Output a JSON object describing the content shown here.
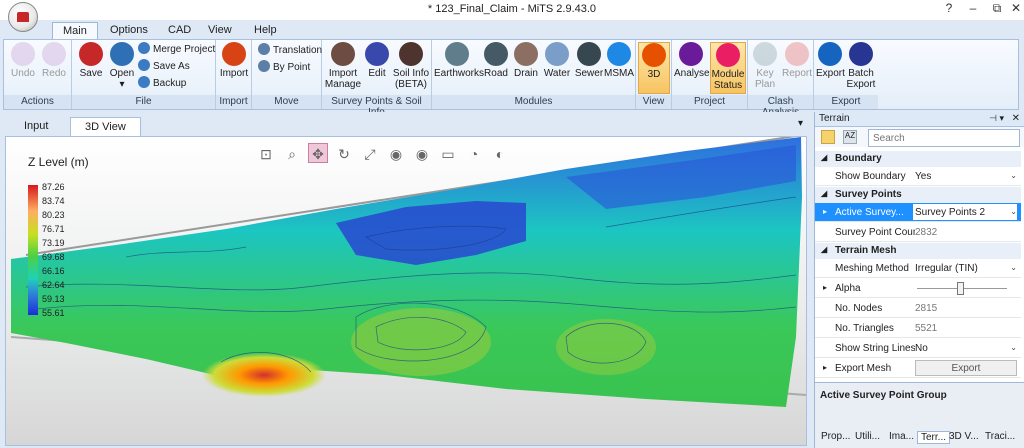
{
  "window": {
    "title": "* 123_Final_Claim - MiTS 2.9.43.0",
    "controls": [
      "?",
      "–",
      "⧉",
      "✕"
    ]
  },
  "tabs": [
    "Main",
    "Options",
    "CAD",
    "View",
    "Help"
  ],
  "ribbon": {
    "actions": {
      "label": "Actions",
      "undo": "Undo",
      "redo": "Redo"
    },
    "file": {
      "label": "File",
      "save": "Save",
      "open": "Open",
      "merge": "Merge Project",
      "saveas": "Save As",
      "backup": "Backup"
    },
    "import": {
      "label": "Import",
      "btn": "Import"
    },
    "move": {
      "label": "Move",
      "translation": "Translation",
      "bypoint": "By Point"
    },
    "survey": {
      "label": "Survey Points & Soil Info",
      "manage1": "Import",
      "manage2": "Manage",
      "edit": "Edit",
      "soil1": "Soil Info",
      "soil2": "(BETA)"
    },
    "modules": {
      "label": "Modules",
      "items": [
        "Earthworks",
        "Road",
        "Drain",
        "Water",
        "Sewer",
        "MSMA"
      ]
    },
    "view": {
      "label": "View",
      "btn": "3D"
    },
    "project": {
      "label": "Project",
      "analyse": "Analyse",
      "status1": "Module",
      "status2": "Status"
    },
    "clash": {
      "label": "Clash Analysis",
      "key1": "Key",
      "key2": "Plan",
      "report": "Report"
    },
    "export": {
      "label": "Export",
      "export": "Export",
      "batch1": "Batch",
      "batch2": "Export"
    }
  },
  "doc": {
    "tabs": [
      "Input",
      "3D View"
    ],
    "menu_arrow": "▾"
  },
  "legend": {
    "title": "Z Level (m)",
    "values": [
      "87.26",
      "83.74",
      "80.23",
      "76.71",
      "73.19",
      "69.68",
      "66.16",
      "62.64",
      "59.13",
      "55.61"
    ]
  },
  "panel": {
    "title": "Terrain",
    "search_placeholder": "Search",
    "categories": {
      "boundary": "Boundary",
      "survey": "Survey Points",
      "mesh": "Terrain Mesh"
    },
    "rows": {
      "show_boundary": {
        "name": "Show Boundary",
        "value": "Yes"
      },
      "active_survey": {
        "name": "Active Survey...",
        "value": "Survey Points 2"
      },
      "point_count": {
        "name": "Survey Point Count",
        "value": "2832"
      },
      "meshing": {
        "name": "Meshing Method",
        "value": "Irregular (TIN)"
      },
      "alpha": {
        "name": "Alpha"
      },
      "nodes": {
        "name": "No. Nodes",
        "value": "2815"
      },
      "triangles": {
        "name": "No. Triangles",
        "value": "5521"
      },
      "strings": {
        "name": "Show String Lines",
        "value": "No"
      },
      "export": {
        "name": "Export Mesh",
        "value": "Export"
      }
    },
    "description": "Active Survey Point Group",
    "bottom_tabs": [
      "Prop...",
      "Utili...",
      "Ima...",
      "Terr...",
      "3D V...",
      "Traci..."
    ]
  },
  "colors": {
    "accent": "#f7c462",
    "selection": "#1e90ff"
  }
}
